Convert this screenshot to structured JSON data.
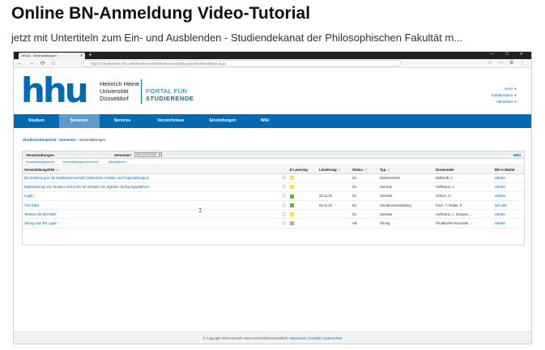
{
  "video": {
    "title": "Online BN-Anmeldung Video-Tutorial",
    "subtitle": "jetzt mit Untertiteln zum Ein- und Ausblenden - Studiendekanat der Philosophischen Fakultät m..."
  },
  "browser": {
    "tab_title": "HHUD - Veranstaltungen",
    "new_tab_symbol": "+",
    "url": "https://studierende.hhu.de/MeinSemester/Meineveranstaltungen/Seiten/default.aspx",
    "window_controls": "— ☐ ✕"
  },
  "site": {
    "logo_text": "hhu",
    "uni_line1": "Heinrich Heine",
    "uni_line2": "Universität",
    "uni_line3": "Düsseldorf",
    "portal_line1": "PORTAL FÜR",
    "portal_line2": "STUDIERENDE",
    "top_links": [
      "HHU ➜",
      "Kollaboration ➜",
      "Abmelden ➜"
    ],
    "nav": [
      {
        "label": "Studium",
        "active": false
      },
      {
        "label": "Semester",
        "active": true
      },
      {
        "label": "Services",
        "active": false
      },
      {
        "label": "Verzeichnisse",
        "active": false
      },
      {
        "label": "Einstellungen",
        "active": false
      },
      {
        "label": "Wiki",
        "active": false
      }
    ],
    "breadcrumb": [
      "Studierendenportal",
      "Semester",
      "Veranstaltungen"
    ],
    "breadcrumb_sep": "›",
    "footer": {
      "copyright": "© Copyright 2018 Heinrich-Heine-Universität Düsseldorf",
      "links": [
        "Impressum",
        "Kontakt",
        "Datenschutz"
      ],
      "sep": "|"
    }
  },
  "panel": {
    "title": "Veranstaltungen",
    "semester_label": "Semester:",
    "semester_value": "WS 2019/2020",
    "wiki": "Wiki",
    "subtabs": [
      "Veranstaltungssuche",
      "Veranstaltungsverzeichnis",
      "Aktualisieren"
    ],
    "columns": [
      "Veranstaltungstitel ↓↑",
      "",
      "E-Learning",
      "Länderung ↓↑",
      "Status ↓↑",
      "Typ ↓↑",
      "Dozierende",
      "BN in Modul"
    ],
    "rows": [
      {
        "title": "BS Einführung in die Musikwissenschaft (Historische Ansätze und Fragestellungen)",
        "info": "ⓘ",
        "elearn_color": "#f2e45c",
        "date": "",
        "status": "ZU",
        "type": "Basisseminar",
        "lecturer": "Bellstedt, A.",
        "action": "wählen"
      },
      {
        "title": "Digitalisierung von Studium und Lehre am Beispiel der digitalen Belegungsplattform",
        "info": "ⓘ",
        "elearn_color": "#f2e45c",
        "date": "",
        "status": "ZU",
        "type": "Seminar",
        "lecturer": "Hoffmann, J.",
        "action": "wählen"
      },
      {
        "title": "Logik I",
        "info": "ⓘ",
        "elearn_color": "#6ab04c",
        "date": "05.11.20",
        "status": "ZU",
        "type": "Seminar",
        "lecturer": "Schurz, G.",
        "action": "wählen"
      },
      {
        "title": "Test EWS",
        "info": "ⓘ",
        "elearn_color": "#6ab04c",
        "date": "08.11.20",
        "status": "ZU",
        "type": "Sonderveranstaltung",
        "lecturer": "Koch, T. Rütter, P.",
        "action": "kein BN"
      },
      {
        "title": "Testkurs für BN-Wahl",
        "info": "ⓘ",
        "elearn_color": "#f2e45c",
        "date": "",
        "status": "ZU",
        "type": "Seminar",
        "lecturer": "Hoffmann, J. Kempen ...",
        "action": "wählen"
      },
      {
        "title": "Übung zum BS Logik I",
        "info": "ⓘ",
        "elearn_color": "#e69a9a",
        "date": "",
        "status": "AB",
        "type": "Übung",
        "lecturer": "Flindbacher-Escamila ...",
        "action": "wählen"
      }
    ]
  }
}
